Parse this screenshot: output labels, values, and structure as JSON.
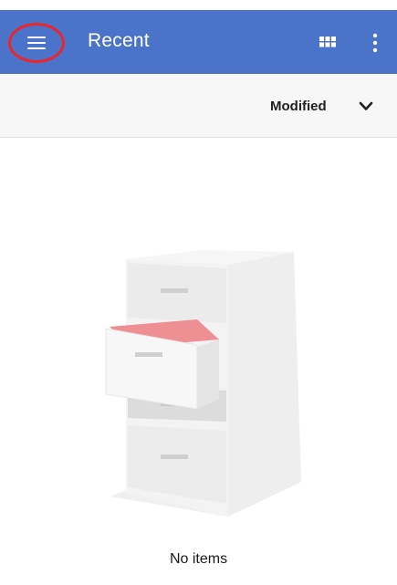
{
  "app_bar": {
    "title": "Recent",
    "color": "#4a73c9",
    "menu_icon": "hamburger-menu-icon",
    "grid_icon": "grid-view-icon",
    "more_icon": "more-vert-icon",
    "highlight_color": "#e8262b"
  },
  "sort_bar": {
    "label": "Modified",
    "chevron_icon": "chevron-down-icon"
  },
  "empty_state": {
    "illustration": "file-cabinet-illustration",
    "message": "No items",
    "accent_color": "#ee8f93"
  }
}
